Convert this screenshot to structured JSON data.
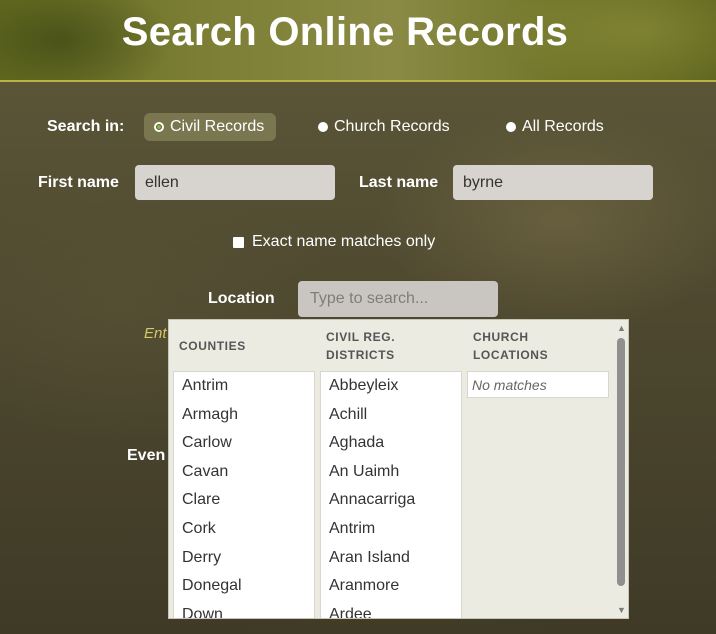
{
  "header": {
    "title": "Search Online Records"
  },
  "search_in": {
    "label": "Search in:",
    "options": [
      {
        "label": "Civil Records",
        "selected": true
      },
      {
        "label": "Church Records",
        "selected": false
      },
      {
        "label": "All Records",
        "selected": false
      }
    ]
  },
  "first_name": {
    "label": "First name",
    "value": "ellen"
  },
  "last_name": {
    "label": "Last name",
    "value": "byrne"
  },
  "exact_match": {
    "label": "Exact name matches only",
    "checked": false
  },
  "location": {
    "label": "Location",
    "placeholder": "Type to search..."
  },
  "hint": "Ent",
  "event_label": "Even",
  "dropdown": {
    "counties": {
      "heading_line1": "COUNTIES",
      "items": [
        "Antrim",
        "Armagh",
        "Carlow",
        "Cavan",
        "Clare",
        "Cork",
        "Derry",
        "Donegal",
        "Down"
      ]
    },
    "districts": {
      "heading_line1": "CIVIL REG.",
      "heading_line2": "DISTRICTS",
      "items": [
        "Abbeyleix",
        "Achill",
        "Aghada",
        "An Uaimh",
        "Annacarriga",
        "Antrim",
        "Aran Island",
        "Aranmore",
        "Ardee"
      ]
    },
    "church": {
      "heading_line1": "CHURCH",
      "heading_line2": "LOCATIONS",
      "no_matches": "No matches"
    }
  },
  "colors": {
    "selected_radio_bg": "#7a7650",
    "hint_text": "#d7c86a",
    "header_border": "#b7b443"
  }
}
